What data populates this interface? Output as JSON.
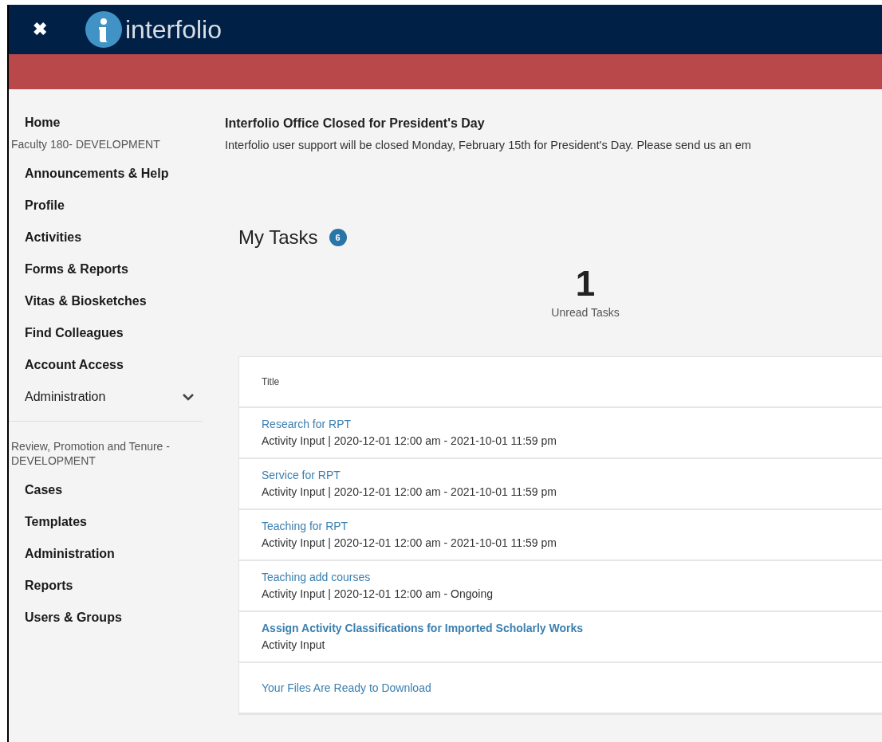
{
  "header": {
    "logo_text": "interfolio",
    "close_label": "✖"
  },
  "sidebar": {
    "home": "Home",
    "sections": [
      {
        "title": "Faculty 180- DEVELOPMENT",
        "items": [
          {
            "label": "Announcements & Help",
            "kind": "link"
          },
          {
            "label": "Profile",
            "kind": "link"
          },
          {
            "label": "Activities",
            "kind": "link"
          },
          {
            "label": "Forms & Reports",
            "kind": "link"
          },
          {
            "label": "Vitas & Biosketches",
            "kind": "link"
          },
          {
            "label": "Find Colleagues",
            "kind": "link"
          },
          {
            "label": "Account Access",
            "kind": "link"
          },
          {
            "label": "Administration",
            "kind": "group",
            "expanded": false
          }
        ]
      },
      {
        "title": "Review, Promotion and Tenure - DEVELOPMENT",
        "items": [
          {
            "label": "Cases",
            "kind": "link"
          },
          {
            "label": "Templates",
            "kind": "link"
          },
          {
            "label": "Administration",
            "kind": "link"
          },
          {
            "label": "Reports",
            "kind": "link"
          },
          {
            "label": "Users & Groups",
            "kind": "link"
          }
        ]
      }
    ]
  },
  "announcement": {
    "title": "Interfolio Office Closed for President's Day",
    "body": "Interfolio user support will be closed Monday, February 15th for President's Day. Please send us an em"
  },
  "tasks": {
    "title": "My Tasks",
    "badge": "6",
    "unread_count": "1",
    "unread_label": "Unread Tasks",
    "columns": [
      "Title"
    ],
    "rows": [
      {
        "title": "Research for RPT",
        "detail": "Activity Input | 2020-12-01 12:00 am - 2021-10-01 11:59 pm",
        "unread": false
      },
      {
        "title": "Service for RPT",
        "detail": "Activity Input | 2020-12-01 12:00 am - 2021-10-01 11:59 pm",
        "unread": false
      },
      {
        "title": "Teaching for RPT",
        "detail": "Activity Input | 2020-12-01 12:00 am - 2021-10-01 11:59 pm",
        "unread": false
      },
      {
        "title": "Teaching add courses",
        "detail": "Activity Input | 2020-12-01 12:00 am - Ongoing",
        "unread": false
      },
      {
        "title": "Assign Activity Classifications for Imported Scholarly Works",
        "detail": "Activity Input",
        "unread": true
      },
      {
        "title": "Your Files Are Ready to Download",
        "unread": false
      }
    ]
  }
}
